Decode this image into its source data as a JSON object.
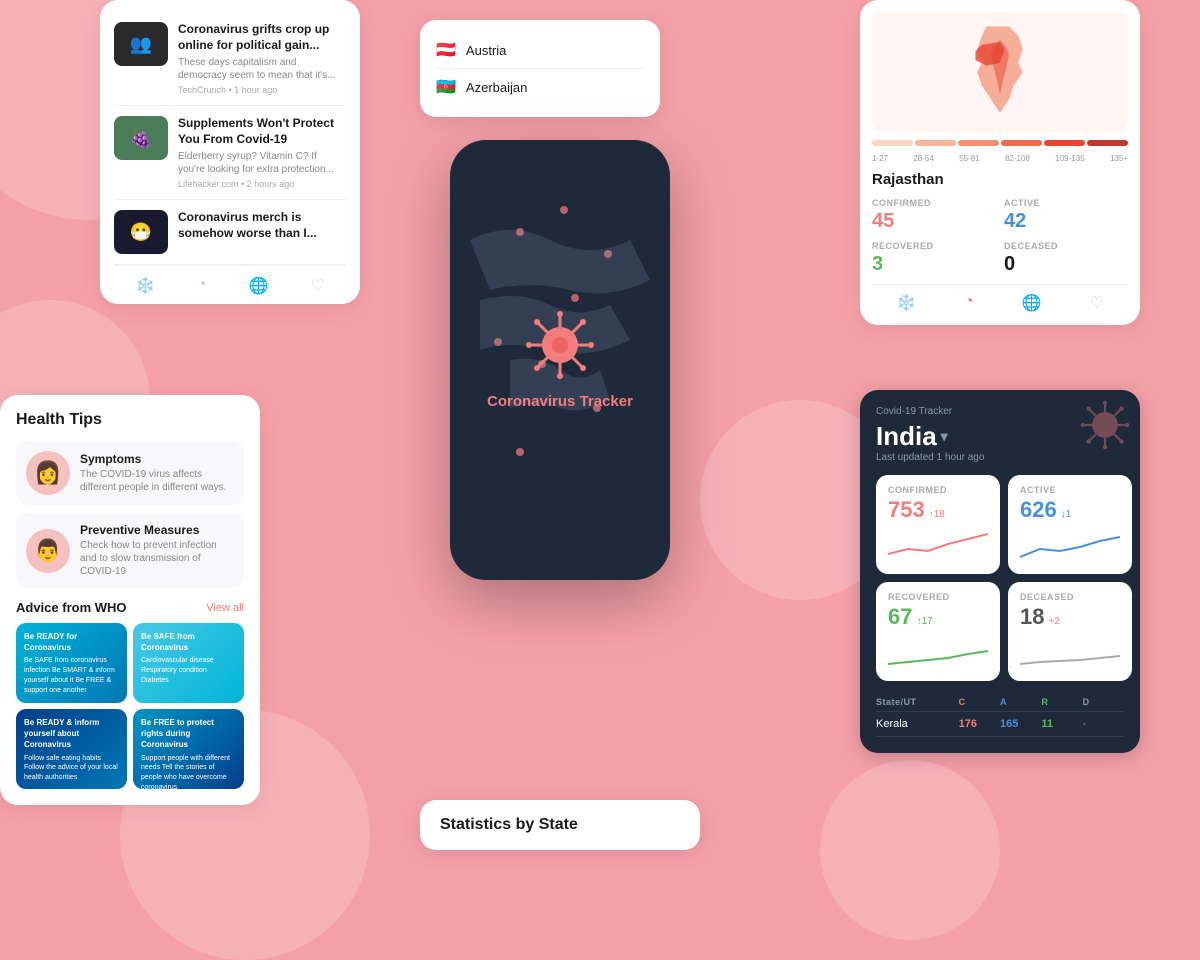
{
  "background": "#f4a0a8",
  "news": {
    "items": [
      {
        "title": "Coronavirus grifts crop up online for political gain...",
        "desc": "These days capitalism and democracy seem to mean that it's...",
        "source": "TechCrunch • 1 hour ago",
        "thumb": "👥",
        "thumbBg": "thumb-dark"
      },
      {
        "title": "Supplements Won't Protect You From Covid-19",
        "desc": "Elderberry syrup? Vitamin C? If you're looking for extra protection...",
        "source": "Lifehacker.com • 2 hours ago",
        "thumb": "🍇",
        "thumbBg": "thumb-green"
      },
      {
        "title": "Coronavirus merch is somehow worse than I...",
        "desc": "",
        "source": "",
        "thumb": "😷",
        "thumbBg": "thumb-dark2"
      }
    ],
    "navIcons": [
      "❄️",
      "◔",
      "🌐",
      "♡"
    ]
  },
  "healthTips": {
    "title": "Health Tips",
    "items": [
      {
        "title": "Symptoms",
        "desc": "The COVID-19 virus affects different people in different ways.",
        "avatar": "👩"
      },
      {
        "title": "Preventive Measures",
        "desc": "Check how to prevent infection and to slow transmission of COVID-19",
        "avatar": "👨"
      }
    ],
    "whoTitle": "Advice from WHO",
    "whoLink": "View all",
    "whoCards": [
      {
        "head": "Be READY for Coronavirus",
        "body": "Be SAFE from coronavirus infection\nBe SMART & inform yourself about it\nBe FREE & support one another"
      },
      {
        "head": "Be SAFE from Coronavirus",
        "body": "Cardiovascular disease\nRespiratory condition\nDiabetes"
      },
      {
        "head": "Be READY & inform yourself about Coronavirus",
        "body": "Follow safe eating habits\nFollow the advice of your local health authorities"
      },
      {
        "head": "Be FREE to protect rights during Coronavirus",
        "body": "Support people with different needs\nTell the stories of people who have overcome coronavirus"
      }
    ]
  },
  "countries": [
    {
      "name": "Austria",
      "flag": "🇦🇹"
    },
    {
      "name": "Azerbaijan",
      "flag": "🇦🇿"
    }
  ],
  "phone": {
    "appName": "Coronavirus Tracker",
    "dots": [
      {
        "top": "20%",
        "left": "30%"
      },
      {
        "top": "35%",
        "left": "55%"
      },
      {
        "top": "50%",
        "left": "40%"
      },
      {
        "top": "60%",
        "left": "65%"
      },
      {
        "top": "25%",
        "left": "70%"
      },
      {
        "top": "70%",
        "left": "30%"
      },
      {
        "top": "15%",
        "left": "50%"
      },
      {
        "top": "45%",
        "left": "20%"
      }
    ]
  },
  "statsState": {
    "title": "Statistics by State"
  },
  "mapCard": {
    "stateName": "Rajasthan",
    "legend": {
      "ranges": [
        "1-27",
        "28-54",
        "55-81",
        "82-108",
        "109-135",
        "135+"
      ],
      "colors": [
        "#fdd5c0",
        "#f9b49a",
        "#f49070",
        "#ef6b4e",
        "#e84430",
        "#c0392b"
      ]
    },
    "stats": [
      {
        "label": "CONFIRMED",
        "value": "45",
        "colorClass": "val-red"
      },
      {
        "label": "ACTIVE",
        "value": "42",
        "colorClass": "val-blue"
      },
      {
        "label": "RECOVERED",
        "value": "3",
        "colorClass": "val-green"
      },
      {
        "label": "DECEASED",
        "value": "0",
        "colorClass": "val-dark"
      }
    ],
    "navIcons": [
      "❄️",
      "◔",
      "🌐",
      "♡"
    ]
  },
  "trackerCard": {
    "appLabel": "Covid-19 Tracker",
    "country": "India",
    "updated": "Last updated 1 hour ago",
    "stats": [
      {
        "label": "CONFIRMED",
        "value": "753",
        "change": "↑18",
        "changeClass": "change-up",
        "color": "#f47c7c",
        "chartPoints": "0,25 20,20 40,22 60,15 80,10 100,5"
      },
      {
        "label": "ACTIVE",
        "value": "626",
        "change": "↓1",
        "changeClass": "change-down",
        "color": "#4a90d9",
        "chartPoints": "0,28 20,20 40,22 60,18 80,12 100,8"
      },
      {
        "label": "RECOVERED",
        "value": "67",
        "change": "↑17",
        "changeClass": "change-green",
        "color": "#5cb85c",
        "chartPoints": "0,28 20,26 40,24 60,22 80,18 100,15"
      },
      {
        "label": "DECEASED",
        "value": "18",
        "change": "+2",
        "changeClass": "change-up",
        "color": "#aaa",
        "chartPoints": "0,28 20,26 40,25 60,24 80,22 100,20"
      }
    ],
    "table": {
      "headers": [
        "State/UT",
        "C",
        "A",
        "R",
        "D"
      ],
      "rows": [
        {
          "state": "Kerala",
          "c": "176",
          "a": "165",
          "r": "11",
          "d": "-"
        }
      ]
    }
  }
}
